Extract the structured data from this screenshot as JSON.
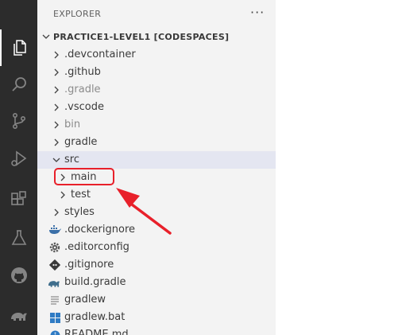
{
  "activity_bar": {
    "items": [
      {
        "icon": "files-icon",
        "active": true
      },
      {
        "icon": "search-icon"
      },
      {
        "icon": "source-control-icon"
      },
      {
        "icon": "run-debug-icon"
      },
      {
        "icon": "extensions-icon"
      },
      {
        "icon": "testing-icon"
      },
      {
        "icon": "github-icon"
      },
      {
        "icon": "gradle-elephant-icon"
      }
    ]
  },
  "explorer": {
    "title": "EXPLORER",
    "more_actions": "···",
    "root_label": "PRACTICE1-LEVEL1 [CODESPACES]",
    "tree": [
      {
        "label": ".devcontainer",
        "kind": "folder"
      },
      {
        "label": ".github",
        "kind": "folder"
      },
      {
        "label": ".gradle",
        "kind": "folder",
        "dim": true
      },
      {
        "label": ".vscode",
        "kind": "folder"
      },
      {
        "label": "bin",
        "kind": "folder",
        "dim": true
      },
      {
        "label": "gradle",
        "kind": "folder"
      },
      {
        "label": "src",
        "kind": "folder",
        "expanded": true,
        "selected": true
      },
      {
        "label": "main",
        "kind": "folder",
        "depth": 1
      },
      {
        "label": "test",
        "kind": "folder",
        "depth": 1
      },
      {
        "label": "styles",
        "kind": "folder"
      },
      {
        "label": ".dockerignore",
        "kind": "file",
        "icon": "docker-icon"
      },
      {
        "label": ".editorconfig",
        "kind": "file",
        "icon": "gear-icon"
      },
      {
        "label": ".gitignore",
        "kind": "file",
        "icon": "git-icon"
      },
      {
        "label": "build.gradle",
        "kind": "file",
        "icon": "gradle-icon"
      },
      {
        "label": "gradlew",
        "kind": "file",
        "icon": "text-file-icon"
      },
      {
        "label": "gradlew.bat",
        "kind": "file",
        "icon": "windows-icon"
      },
      {
        "label": "README.md",
        "kind": "file",
        "icon": "info-icon"
      }
    ]
  },
  "annotation": {
    "highlight_color": "#e8202a",
    "highlighted_item": "main"
  }
}
